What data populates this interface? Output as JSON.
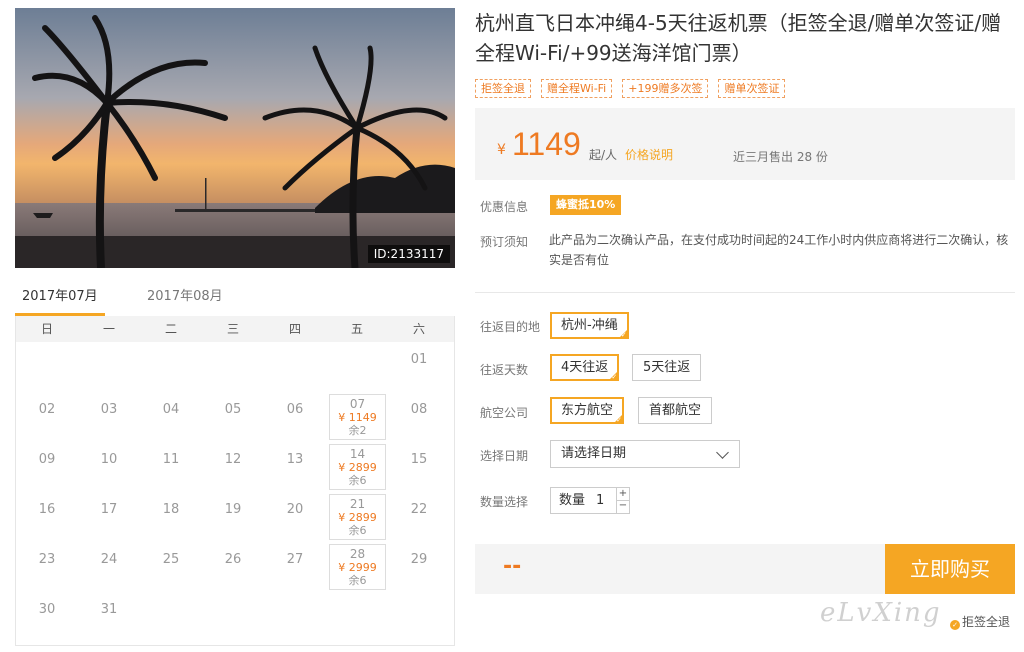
{
  "photo": {
    "id_label": "ID:2133117"
  },
  "calendar": {
    "tabs": [
      {
        "label": "2017年07月",
        "active": true
      },
      {
        "label": "2017年08月",
        "active": false
      }
    ],
    "weekdays": [
      "日",
      "一",
      "二",
      "三",
      "四",
      "五",
      "六"
    ],
    "weeks": [
      [
        null,
        null,
        null,
        null,
        null,
        null,
        {
          "day": "01"
        }
      ],
      [
        {
          "day": "02"
        },
        {
          "day": "03"
        },
        {
          "day": "04"
        },
        {
          "day": "05"
        },
        {
          "day": "06"
        },
        {
          "day": "07",
          "price": "¥ 1149",
          "stock": "余2"
        },
        {
          "day": "08"
        }
      ],
      [
        {
          "day": "09"
        },
        {
          "day": "10"
        },
        {
          "day": "11"
        },
        {
          "day": "12"
        },
        {
          "day": "13"
        },
        {
          "day": "14",
          "price": "¥ 2899",
          "stock": "余6"
        },
        {
          "day": "15"
        }
      ],
      [
        {
          "day": "16"
        },
        {
          "day": "17"
        },
        {
          "day": "18"
        },
        {
          "day": "19"
        },
        {
          "day": "20"
        },
        {
          "day": "21",
          "price": "¥ 2899",
          "stock": "余6"
        },
        {
          "day": "22"
        }
      ],
      [
        {
          "day": "23"
        },
        {
          "day": "24"
        },
        {
          "day": "25"
        },
        {
          "day": "26"
        },
        {
          "day": "27"
        },
        {
          "day": "28",
          "price": "¥ 2999",
          "stock": "余6"
        },
        {
          "day": "29"
        }
      ],
      [
        {
          "day": "30"
        },
        {
          "day": "31"
        },
        null,
        null,
        null,
        null,
        null
      ]
    ]
  },
  "product": {
    "title": "杭州直飞日本冲绳4-5天往返机票（拒签全退/赠单次签证/赠全程Wi-Fi/+99送海洋馆门票）",
    "tags": [
      "拒签全退",
      "赠全程Wi-Fi",
      "+199赠多次签",
      "赠单次签证"
    ]
  },
  "price_box": {
    "currency": "¥",
    "price": "1149",
    "unit": "起/人",
    "explain_link": "价格说明",
    "sold": "近三月售出 28 份"
  },
  "info": {
    "promo_label": "优惠信息",
    "promo_badge": "蜂蜜抵10%",
    "notice_label": "预订须知",
    "notice_text": "此产品为二次确认产品，在支付成功时间起的24工作小时内供应商将进行二次确认，核实是否有位"
  },
  "options": {
    "destination": {
      "label": "往返目的地",
      "choices": [
        "杭州-冲绳"
      ]
    },
    "days": {
      "label": "往返天数",
      "choices": [
        "4天往返",
        "5天往返"
      ]
    },
    "airline": {
      "label": "航空公司",
      "choices": [
        "东方航空",
        "首都航空"
      ]
    },
    "date": {
      "label": "选择日期",
      "placeholder": "请选择日期"
    },
    "quantity": {
      "label": "数量选择",
      "field_label": "数量",
      "value": "1",
      "plus": "+",
      "minus": "−"
    }
  },
  "purchase": {
    "total": "--",
    "buy_label": "立即购买"
  },
  "watermark": "eLvXing",
  "refund_note": "拒签全退",
  "colors": {
    "accent": "#f5a623",
    "price": "#ee7a22"
  }
}
